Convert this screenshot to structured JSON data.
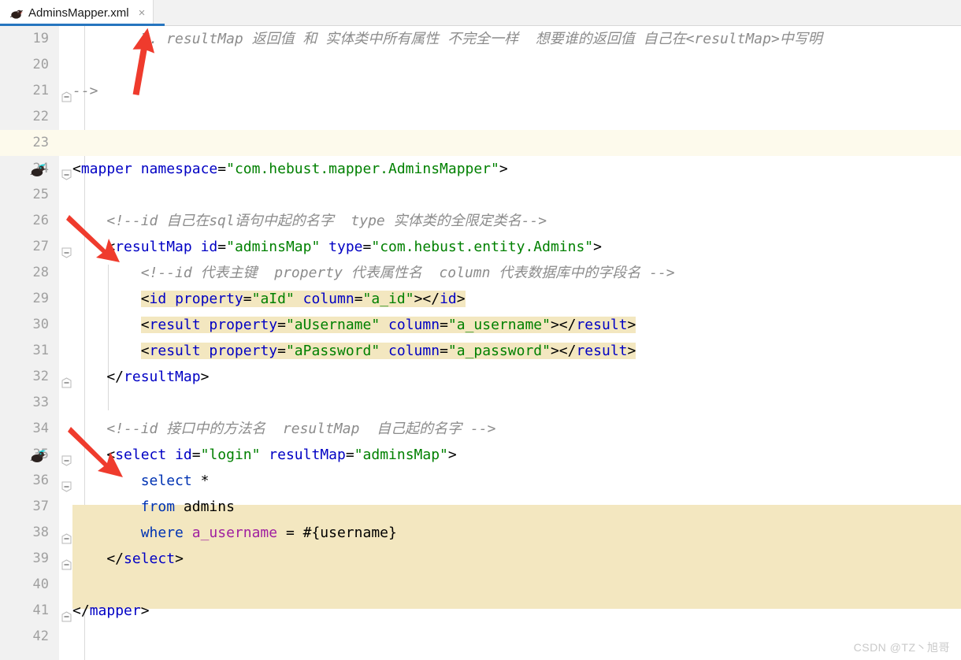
{
  "tab": {
    "label": "AdminsMapper.xml",
    "icon": "xml-file-icon",
    "close_icon": "close-icon",
    "accent_color": "#2675bf"
  },
  "editor": {
    "theme_colors": {
      "background": "#ffffff",
      "gutter": "#f1f1f1",
      "line_number": "#a0a0a0",
      "caret_line": "#fdfaec",
      "selection_highlight": "#f3e7c0",
      "tag": "#0000c4",
      "attribute": "#0000c4",
      "attribute_value": "#008000",
      "comment": "#8c8c8c",
      "sql_keyword": "#0033b3",
      "sql_column": "#a020a0"
    },
    "first_line": 19,
    "lines": [
      {
        "n": 19,
        "text": "        7. resultMap 返回值 和 实体类中所有属性 不完全一样  想要谁的返回值 自己在<resultMap>中写明"
      },
      {
        "n": 20,
        "text": ""
      },
      {
        "n": 21,
        "text": "-->"
      },
      {
        "n": 22,
        "text": ""
      },
      {
        "n": 23,
        "text": ""
      },
      {
        "n": 24,
        "text": "<mapper namespace=\"com.hebust.mapper.AdminsMapper\">"
      },
      {
        "n": 25,
        "text": ""
      },
      {
        "n": 26,
        "text": "    <!--id 自己在sql语句中起的名字  type 实体类的全限定类名-->"
      },
      {
        "n": 27,
        "text": "    <resultMap id=\"adminsMap\" type=\"com.hebust.entity.Admins\">"
      },
      {
        "n": 28,
        "text": "        <!--id 代表主键  property 代表属性名  column 代表数据库中的字段名 -->"
      },
      {
        "n": 29,
        "text": "        <id property=\"aId\" column=\"a_id\"></id>"
      },
      {
        "n": 30,
        "text": "        <result property=\"aUsername\" column=\"a_username\"></result>"
      },
      {
        "n": 31,
        "text": "        <result property=\"aPassword\" column=\"a_password\"></result>"
      },
      {
        "n": 32,
        "text": "    </resultMap>"
      },
      {
        "n": 33,
        "text": ""
      },
      {
        "n": 34,
        "text": "    <!--id 接口中的方法名  resultMap  自己起的名字 -->"
      },
      {
        "n": 35,
        "text": "    <select id=\"login\" resultMap=\"adminsMap\">"
      },
      {
        "n": 36,
        "text": "        select *"
      },
      {
        "n": 37,
        "text": "        from admins"
      },
      {
        "n": 38,
        "text": "        where a_username = #{username}"
      },
      {
        "n": 39,
        "text": "    </select>"
      },
      {
        "n": 40,
        "text": ""
      },
      {
        "n": 41,
        "text": "</mapper>"
      },
      {
        "n": 42,
        "text": ""
      }
    ],
    "gutter_icons": [
      {
        "line": 24,
        "icon": "mybatis-bird-icon"
      },
      {
        "line": 35,
        "icon": "mybatis-bird-icon"
      }
    ],
    "fold_markers": [
      {
        "line": 21,
        "icon": "fold-collapse-icon",
        "direction": "up"
      },
      {
        "line": 24,
        "icon": "fold-collapse-icon",
        "direction": "down"
      },
      {
        "line": 27,
        "icon": "fold-collapse-icon",
        "direction": "down"
      },
      {
        "line": 32,
        "icon": "fold-collapse-icon",
        "direction": "up"
      },
      {
        "line": 35,
        "icon": "fold-collapse-icon",
        "direction": "down"
      },
      {
        "line": 36,
        "icon": "fold-collapse-icon",
        "direction": "down"
      },
      {
        "line": 38,
        "icon": "fold-collapse-icon",
        "direction": "up"
      },
      {
        "line": 39,
        "icon": "fold-collapse-icon",
        "direction": "up"
      },
      {
        "line": 41,
        "icon": "fold-collapse-icon",
        "direction": "up"
      }
    ],
    "caret_line": 23,
    "highlighted_lines": [
      29,
      30,
      31,
      36,
      37,
      38,
      39
    ],
    "annotations": [
      {
        "name": "arrow-to-resultMap-comment",
        "color": "#ef3b2d",
        "points_to_line": 19
      },
      {
        "name": "arrow-to-resultMap-tag",
        "color": "#ef3b2d",
        "points_to_line": 27
      },
      {
        "name": "arrow-to-select-tag",
        "color": "#ef3b2d",
        "points_to_line": 35
      }
    ]
  },
  "watermark": {
    "text": "CSDN @TZ丶旭哥"
  }
}
